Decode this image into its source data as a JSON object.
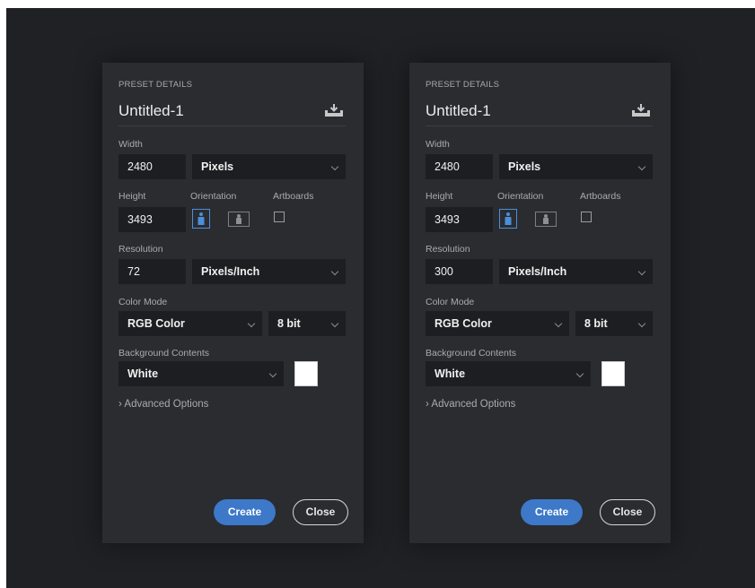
{
  "panels": [
    {
      "section_title": "PRESET DETAILS",
      "document_name": "Untitled-1",
      "width_label": "Width",
      "width_value": "2480",
      "width_unit": "Pixels",
      "height_label": "Height",
      "height_value": "3493",
      "orientation_label": "Orientation",
      "orientation_selected": "portrait",
      "artboards_label": "Artboards",
      "artboards_checked": false,
      "resolution_label": "Resolution",
      "resolution_value": "72",
      "resolution_unit": "Pixels/Inch",
      "color_mode_label": "Color Mode",
      "color_mode": "RGB Color",
      "bit_depth": "8 bit",
      "background_label": "Background Contents",
      "background": "White",
      "background_swatch_color": "#ffffff",
      "advanced_options": "Advanced Options",
      "create_label": "Create",
      "close_label": "Close"
    },
    {
      "section_title": "PRESET DETAILS",
      "document_name": "Untitled-1",
      "width_label": "Width",
      "width_value": "2480",
      "width_unit": "Pixels",
      "height_label": "Height",
      "height_value": "3493",
      "orientation_label": "Orientation",
      "orientation_selected": "portrait",
      "artboards_label": "Artboards",
      "artboards_checked": false,
      "resolution_label": "Resolution",
      "resolution_value": "300",
      "resolution_unit": "Pixels/Inch",
      "color_mode_label": "Color Mode",
      "color_mode": "RGB Color",
      "bit_depth": "8 bit",
      "background_label": "Background Contents",
      "background": "White",
      "background_swatch_color": "#ffffff",
      "advanced_options": "Advanced Options",
      "create_label": "Create",
      "close_label": "Close"
    }
  ],
  "icons": {
    "save_preset": "save-preset-icon",
    "advanced_chevron": "chevron-right-icon",
    "dropdown_chevron": "chevron-down-icon",
    "portrait": "portrait-orientation-icon",
    "landscape": "landscape-orientation-icon"
  },
  "colors": {
    "accent": "#3d78c9",
    "selected_orientation": "#4a8fdc",
    "panel_bg": "#2a2c30",
    "field_bg": "#1d1e21"
  }
}
